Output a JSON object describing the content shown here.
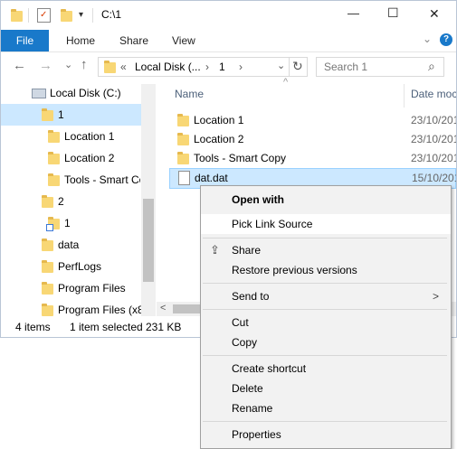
{
  "titlebar": {
    "path": "C:\\1",
    "minimize_glyph": "—",
    "maximize_glyph": "☐",
    "close_glyph": "✕"
  },
  "ribbon": {
    "tabs": [
      "File",
      "Home",
      "Share",
      "View"
    ],
    "expand_glyph": "⌄",
    "help_glyph": "?"
  },
  "nav": {
    "back_glyph": "←",
    "forward_glyph": "→",
    "recent_glyph": "⌄",
    "up_glyph": "↑",
    "address_segments": [
      "«",
      "Local Disk (...",
      "›",
      "1",
      "›"
    ],
    "address_dropdown_glyph": "⌄",
    "refresh_glyph": "↻",
    "search_placeholder": "Search 1",
    "search_glyph": "⌕"
  },
  "tree": {
    "items": [
      {
        "label": "Local Disk (C:)",
        "icon": "drive-icon"
      },
      {
        "label": "1",
        "icon": "folder-icon"
      },
      {
        "label": "Location 1",
        "icon": "folder-icon"
      },
      {
        "label": "Location 2",
        "icon": "folder-icon"
      },
      {
        "label": "Tools - Smart Co",
        "icon": "folder-icon"
      },
      {
        "label": "2",
        "icon": "folder-icon"
      },
      {
        "label": "1",
        "icon": "folder-link-icon"
      },
      {
        "label": "data",
        "icon": "folder-icon"
      },
      {
        "label": "PerfLogs",
        "icon": "folder-icon"
      },
      {
        "label": "Program Files",
        "icon": "folder-icon"
      },
      {
        "label": "Program Files (x8",
        "icon": "folder-icon"
      }
    ]
  },
  "list": {
    "columns": [
      "Name",
      "Date moc"
    ],
    "sort_glyph": "^",
    "items": [
      {
        "name": "Location 1",
        "date": "23/10/201",
        "icon": "folder-icon"
      },
      {
        "name": "Location 2",
        "date": "23/10/201",
        "icon": "folder-icon"
      },
      {
        "name": "Tools - Smart Copy",
        "date": "23/10/201",
        "icon": "folder-icon"
      },
      {
        "name": "dat.dat",
        "date": "15/10/201",
        "icon": "file-icon"
      }
    ],
    "hscroll_left_glyph": "<"
  },
  "status": {
    "count": "4 items",
    "selection": "1 item selected",
    "size": "231 KB"
  },
  "context_menu": {
    "open_with": "Open with",
    "pick_link_source": "Pick Link Source",
    "share": "Share",
    "restore": "Restore previous versions",
    "send_to": "Send to",
    "send_to_arrow": ">",
    "cut": "Cut",
    "copy": "Copy",
    "create_shortcut": "Create shortcut",
    "delete": "Delete",
    "rename": "Rename",
    "properties": "Properties"
  },
  "colors": {
    "accent": "#1979ca",
    "selection": "#cce8ff",
    "folder": "#f8d775",
    "menu_bg": "#f2f2f2"
  }
}
